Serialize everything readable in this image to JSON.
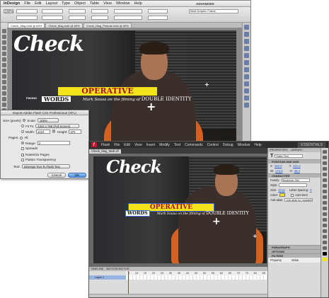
{
  "indesign": {
    "menu": [
      "InDesign",
      "File",
      "Edit",
      "Layout",
      "Type",
      "Object",
      "Table",
      "View",
      "Window",
      "Help"
    ],
    "zoom": "100%",
    "workspace": "ADVANCED",
    "tabs": [
      "Check_Mag.indd @ 69%",
      "Check_Mag.indd @ 69%",
      "Check_Mag_Prelude.indd @ 69%"
    ],
    "font": "Best Graphic Frame",
    "magazine": {
      "logo": "Check",
      "kicker": "FAKING",
      "banner": "OPERATIVE",
      "words": "WORDS",
      "tagline_prefix": "Mark Sousa on the filming of",
      "tagline_title": "DOUBLE IDENTITY"
    }
  },
  "dialog": {
    "title": "Export Adobe Flash CS4 Professional (XFL)",
    "size_label": "Size (pixels):",
    "scale_label": "Scale:",
    "scale_value": "100%",
    "fit_label": "Fit To:",
    "fit_value": "1024 x 768 (Full Screen)",
    "width_label": "Width:",
    "width_value": "1024",
    "height_label": "Height:",
    "height_value": "576",
    "pages_label": "Pages:",
    "all_label": "All",
    "range_label": "Range:",
    "range_value": "2",
    "spreads_label": "Spreads",
    "rasterize_label": "Rasterize Pages",
    "flatten_label": "Flatten Transparency",
    "text_label": "Text:",
    "text_value": "InDesign Text To Flash Text",
    "cancel": "Cancel",
    "ok": "OK"
  },
  "flash": {
    "menu": [
      "Flash",
      "File",
      "Edit",
      "View",
      "Insert",
      "Modify",
      "Text",
      "Commands",
      "Control",
      "Debug",
      "Window",
      "Help"
    ],
    "workspace": "ESSENTIALS",
    "doc_tab": "Check_Mag_Web.xfl",
    "timeline_tabs": [
      "TIMELINE",
      "MOTION EDITOR"
    ],
    "layer": "Layer 1",
    "ruler": [
      "5",
      "10",
      "15",
      "20",
      "25",
      "30",
      "35",
      "40",
      "45",
      "50",
      "55",
      "60",
      "65",
      "70",
      "75",
      "80",
      "85"
    ],
    "props": {
      "tabs": [
        "PROPERTIES",
        "LIBRARY"
      ],
      "text_tool": "Static Text",
      "pos_section": "POSITION AND SIZE",
      "x_label": "X:",
      "x_value": "262.0",
      "y_label": "Y:",
      "y_value": "221.0",
      "w_label": "W:",
      "w_value": "174.0",
      "h_label": "H:",
      "h_value": "46.4",
      "char_section": "CHARACTER",
      "family_label": "Family:",
      "family_value": "Bookman Old",
      "style_label": "Style:",
      "size_label": "Size:",
      "size_value": "22 pt",
      "spacing_label": "Letter spacing:",
      "spacing_value": "0",
      "color_label": "Color:",
      "autokern_label": "Auto kern",
      "antialias_label": "Anti-alias:",
      "antialias_value": "Anti-alias for readability",
      "paragraph": "PARAGRAPH",
      "options": "OPTIONS",
      "filters": "FILTERS",
      "filter_col1": "Property",
      "filter_col2": "Value"
    },
    "magazine": {
      "logo": "Check",
      "banner": "OPERATIVE",
      "words": "WORDS",
      "tagline_prefix": "Mark Sousa on the filming of",
      "tagline_title": "DOUBLE IDENTITY"
    }
  },
  "colors": {
    "banner_yellow": "#f2e31a",
    "banner_red": "#b0102a",
    "chair_orange": "#d4611f",
    "flash_red": "#c0172c"
  }
}
